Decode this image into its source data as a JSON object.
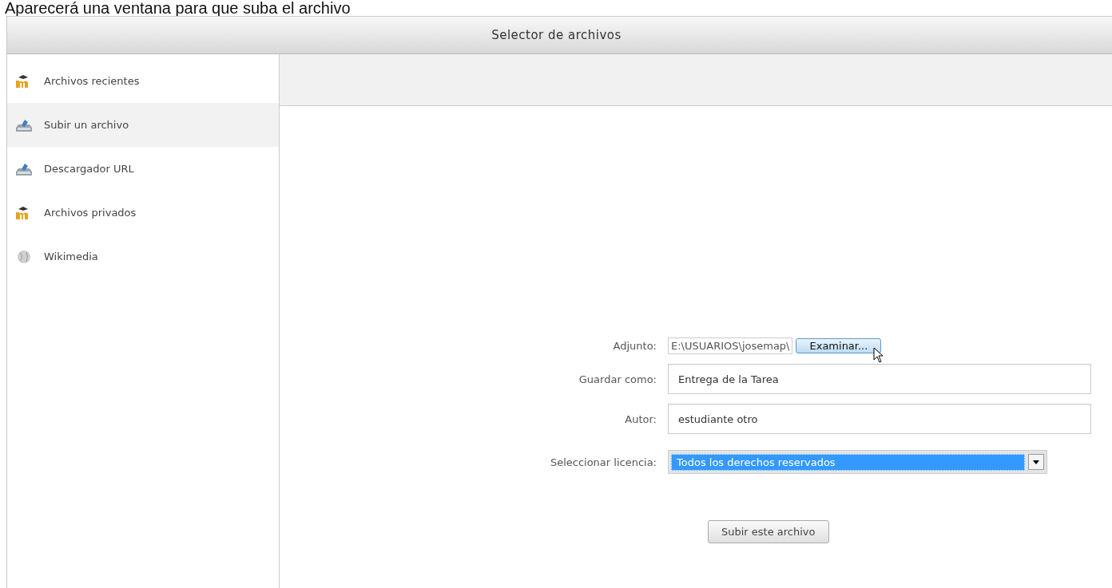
{
  "caption": "Aparecerá una ventana para que suba el archivo",
  "window": {
    "title": "Selector de archivos"
  },
  "sidebar": {
    "items": [
      {
        "label": "Archivos recientes",
        "kind": "moodle",
        "selected": false
      },
      {
        "label": "Subir un archivo",
        "kind": "upload",
        "selected": true
      },
      {
        "label": "Descargador URL",
        "kind": "upload",
        "selected": false
      },
      {
        "label": "Archivos privados",
        "kind": "moodle",
        "selected": false
      },
      {
        "label": "Wikimedia",
        "kind": "wikimedia",
        "selected": false
      }
    ]
  },
  "form": {
    "fields": [
      {
        "label": "Adjunto:",
        "kind": "file",
        "value": "E:\\USUARIOS\\josemap\\",
        "button": "Examinar..."
      },
      {
        "label": "Guardar como:",
        "kind": "text",
        "value": "Entrega de la Tarea"
      },
      {
        "label": "Autor:",
        "kind": "text",
        "value": "estudiante otro"
      },
      {
        "label": "Seleccionar licencia:",
        "kind": "select",
        "value": "Todos los derechos reservados"
      }
    ],
    "submit": "Subir este archivo"
  }
}
